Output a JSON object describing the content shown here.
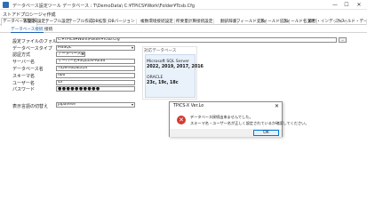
{
  "window": {
    "title": "データベース設定ツール  データベース : T\\DemoData\\  C:¥TPiCS¥Work\\Folder¥Tcsb.Cfg",
    "minimize": "—",
    "maximize": "☐",
    "close": "✕"
  },
  "menu": {
    "items": [
      "ストアドプロシージャ作成"
    ]
  },
  "tabs": [
    "データベース設定",
    "管理DB設定",
    "テーブル設定",
    "テーブル作成",
    "DB拡張",
    "DBバージョン",
    "複数環境接続設定",
    "所要量計算接続設定",
    "翻訳辞書",
    "フィールド変換",
    "フィールド追加",
    "フィールド名変更",
    "索引・インデックス",
    "フィールド・データメンテナンス"
  ],
  "subtabs": [
    "データベース接続",
    "接続"
  ],
  "form": {
    "folder_label": "設定ファイルのフォルダー",
    "folder_value": "C:¥TPiCS¥Work\\Folder¥Tcsb.Cfg",
    "browse_label": "...",
    "dbtype_label": "データベースタイプ",
    "dbtype_value": "MSSQL",
    "auth_label": "認証方式",
    "auth_value": "データベース認証",
    "server_label": "サーバー名",
    "server_value": "サーバー名¥SQLEXPRESS",
    "dbname_label": "データベース名",
    "dbname_value": "T\\DemoData5X",
    "schema_label": "スキーマ名",
    "schema_value": "dbo",
    "user_label": "ユーザー名",
    "user_value": "sa",
    "password_label": "パスワード",
    "password_value": "●●●●●●●●●●",
    "language_label": "表示言語の切替え",
    "language_value": "Japanese"
  },
  "panel": {
    "title": "対応データベース",
    "db1_name": "Microsoft SQL Server",
    "db1_versions": "2022, 2019, 2017, 2016",
    "db2_name": "ORACLE",
    "db2_versions": "23c, 19c, 18c"
  },
  "dialog": {
    "title": "TPiCS-X Ver.Lo",
    "close": "✕",
    "icon_glyph": "✕",
    "line1": "データベース接続出来ませんでした。",
    "line2": "スキーマ名・ユーザー名が正しく設定されているか確認してください。",
    "ok_label": "OK"
  },
  "colors": {
    "accent": "#0078d7",
    "error": "#d23a32",
    "panel_bg": "#e9f1fb"
  }
}
